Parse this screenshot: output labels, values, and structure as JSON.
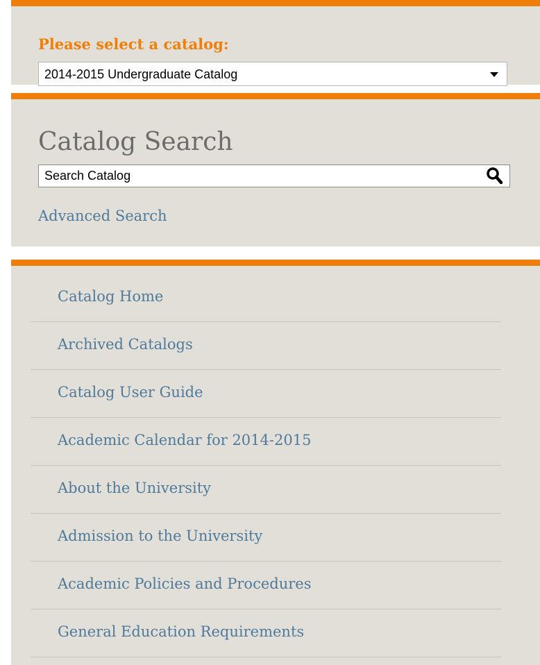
{
  "catalog_picker": {
    "label": "Please select a catalog:",
    "selected": "2014-2015 Undergraduate Catalog"
  },
  "search": {
    "title": "Catalog Search",
    "placeholder": "Search Catalog",
    "advanced_label": "Advanced Search",
    "button_icon": "search-icon"
  },
  "nav": {
    "items": [
      {
        "label": "Catalog Home"
      },
      {
        "label": "Archived Catalogs"
      },
      {
        "label": "Catalog User Guide"
      },
      {
        "label": "Academic Calendar for 2014-2015"
      },
      {
        "label": "About the University"
      },
      {
        "label": "Admission to the University"
      },
      {
        "label": "Academic Policies and Procedures"
      },
      {
        "label": "General Education Requirements"
      }
    ]
  },
  "colors": {
    "accent": "#f07f09",
    "panel_bg": "#e2dfd9",
    "link": "#4f7a99",
    "title": "#6c6c6c"
  }
}
